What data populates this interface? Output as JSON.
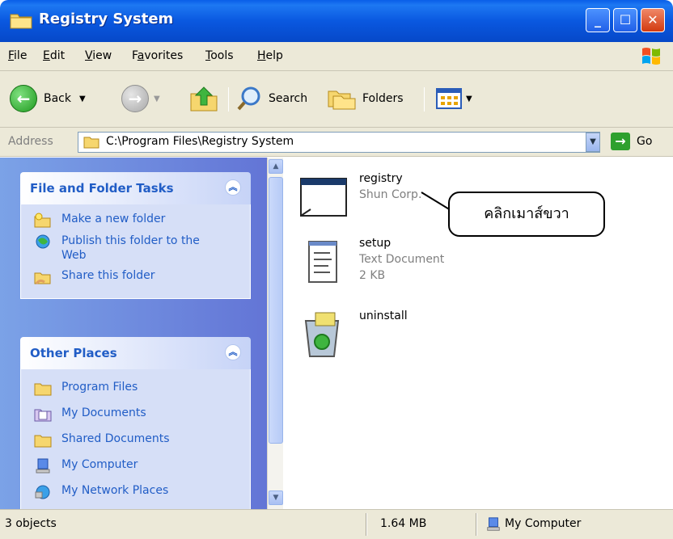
{
  "window": {
    "title": "Registry System",
    "controls": [
      "minimize",
      "maximize",
      "close"
    ]
  },
  "menu": [
    {
      "label": "File",
      "key": "F",
      "rest": "ile"
    },
    {
      "label": "Edit",
      "key": "E",
      "rest": "dit"
    },
    {
      "label": "View",
      "key": "V",
      "rest": "iew"
    },
    {
      "label": "Favorites",
      "key": "a",
      "pre": "F",
      "rest": "vorites"
    },
    {
      "label": "Tools",
      "key": "T",
      "rest": "ools"
    },
    {
      "label": "Help",
      "key": "H",
      "rest": "elp"
    }
  ],
  "toolbar": {
    "back_label": "Back",
    "search_label": "Search",
    "folders_label": "Folders"
  },
  "address": {
    "label": "Address",
    "value": "C:\\Program Files\\Registry System",
    "go_label": "Go"
  },
  "sidebar": {
    "tasks_panel": {
      "title": "File and Folder Tasks",
      "items": [
        {
          "label": "Make a new folder",
          "icon": "new-folder-icon"
        },
        {
          "label": "Publish this folder to the Web",
          "icon": "publish-web-icon"
        },
        {
          "label": "Share this folder",
          "icon": "share-folder-icon"
        }
      ]
    },
    "places_panel": {
      "title": "Other Places",
      "items": [
        {
          "label": "Program Files",
          "icon": "folder-icon"
        },
        {
          "label": "My Documents",
          "icon": "my-documents-icon"
        },
        {
          "label": "Shared Documents",
          "icon": "folder-icon"
        },
        {
          "label": "My Computer",
          "icon": "my-computer-icon"
        },
        {
          "label": "My Network Places",
          "icon": "network-places-icon"
        }
      ]
    }
  },
  "files": [
    {
      "name": "registry",
      "line2": "Shun Corp.",
      "line3": "",
      "icon": "application-window-icon"
    },
    {
      "name": "setup",
      "line2": "Text Document",
      "line3": "2 KB",
      "icon": "text-document-icon"
    },
    {
      "name": "uninstall",
      "line2": "",
      "line3": "",
      "icon": "recycle-bin-icon"
    }
  ],
  "callout": {
    "text": "คลิกเมาส์ขวา"
  },
  "status": {
    "objects": "3 objects",
    "size": "1.64 MB",
    "location": "My Computer"
  }
}
